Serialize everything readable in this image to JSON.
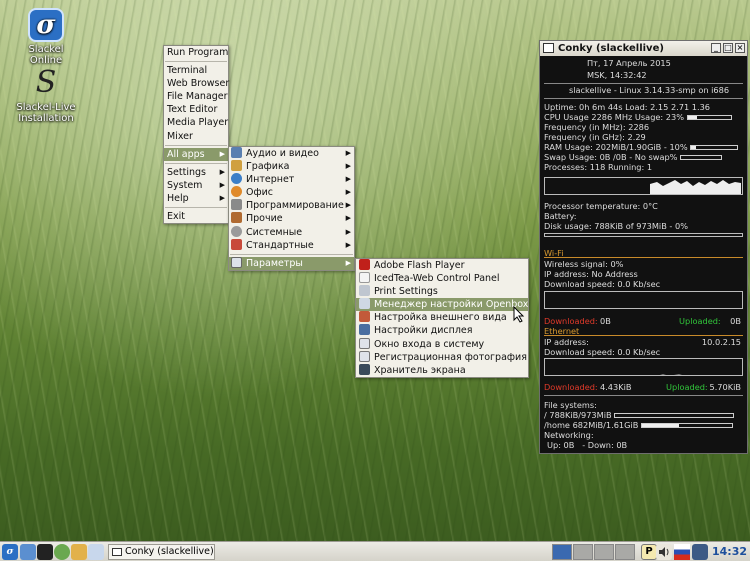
{
  "desktop": {
    "icons": [
      {
        "label": "Slackel Online",
        "glyph": "σ"
      },
      {
        "label": "Slackel-Live Installation",
        "glyph": "S"
      }
    ]
  },
  "main_menu": {
    "items": [
      "Run Program",
      "Terminal",
      "Web Browser",
      "File Manager",
      "Text Editor",
      "Media Player",
      "Mixer",
      "All apps",
      "Settings",
      "System",
      "Help",
      "Exit"
    ]
  },
  "apps_menu": {
    "items": [
      "Аудио и видео",
      "Графика",
      "Интернет",
      "Офис",
      "Программирование",
      "Прочие",
      "Системные",
      "Стандартные",
      "Параметры"
    ]
  },
  "params_menu": {
    "items": [
      "Adobe Flash Player",
      "IcedTea-Web Control Panel",
      "Print Settings",
      "Менеджер настройки Openbox",
      "Настройка внешнего вида",
      "Настройки дисплея",
      "Окно входа в систему",
      "Регистрационная фотография",
      "Хранитель экрана"
    ]
  },
  "conky": {
    "title": "Conky (slackellive)",
    "date": "Пт,   17 Апрель 2015",
    "time": "MSK,     14:32:42",
    "kernel": "slackellive - Linux 3.14.33-smp on i686",
    "uptime": "Uptime:  0h 6m 44s  Load:  2.15  2.71  1.36",
    "cpu_usage": "CPU Usage    2286 MHz  Usage:  23%",
    "cpu_usage_pct": 23,
    "freq_mhz": "Frequency (in MHz):  2286",
    "freq_ghz": "Frequency (in GHz):  2.29",
    "ram": "RAM Usage:  202MiB/1.90GiB - 10%",
    "ram_pct": 10,
    "swap": "Swap Usage:  0B  /0B    - No swap%",
    "processes": "Processes:  118   Running:  1",
    "cpu_temp": "Processor temperature:  0°C",
    "battery": "Battery:",
    "disk": "Disk usage:  788KiB of 973MiB - 0%",
    "disk_pct": 0,
    "wifi_header": "Wi-Fi",
    "wireless_signal": "Wireless signal:  0%",
    "wifi_ip": "IP address:  No Address",
    "wifi_speed": "Download speed:  0.0 Kb/sec",
    "wifi_downloaded_label": "Downloaded:",
    "wifi_downloaded": "0B",
    "wifi_uploaded_label": "Uploaded:",
    "wifi_uploaded": "0B",
    "eth_header": "Ethernet",
    "eth_ip_label": "IP address:",
    "eth_ip": "10.0.2.15",
    "eth_speed": "Download speed:  0.0 Kb/sec",
    "eth_downloaded_label": "Downloaded:",
    "eth_downloaded": "4.43KiB",
    "eth_uploaded_label": "Uploaded:",
    "eth_uploaded": "5.70KiB",
    "fs_header": "File systems:",
    "fs_root": " /  788KiB/973MiB",
    "fs_root_pct": 0,
    "fs_home": "/home  682MiB/1.61GiB",
    "fs_home_pct": 41,
    "networking": "Networking:",
    "net_up": "Up:  0B",
    "net_down": "- Down:  0B"
  },
  "taskbar": {
    "task_label": "Conky (slackellive)",
    "clock": "14:32"
  },
  "colors": {
    "download": "#e03a2a",
    "upload": "#31c43a",
    "section_header": "#d99a30",
    "pager_active": "#3a69b0"
  }
}
